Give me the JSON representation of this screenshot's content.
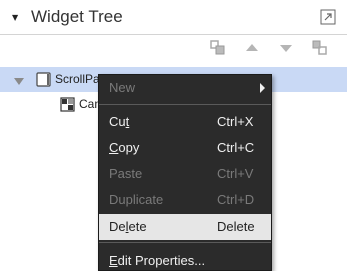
{
  "header": {
    "title": "Widget Tree",
    "collapse_icon": "triangle-down-icon",
    "restore_icon": "restore-window-icon"
  },
  "toolbar": {
    "icons": [
      "wrap-icon",
      "move-up-icon",
      "move-down-icon",
      "unwrap-icon"
    ]
  },
  "tree": {
    "rows": [
      {
        "label": "ScrollPa",
        "icon": "scroll-panel-icon",
        "selected": true,
        "expanded": true
      },
      {
        "label": "Can",
        "icon": "canvas-icon",
        "selected": false
      }
    ]
  },
  "context_menu": {
    "items": [
      {
        "label": "New",
        "shortcut": "",
        "disabled": true,
        "submenu": true,
        "mnemonic": ""
      },
      {
        "label": "Cut",
        "shortcut": "Ctrl+X",
        "disabled": false,
        "mnemonic": "t"
      },
      {
        "label": "Copy",
        "shortcut": "Ctrl+C",
        "disabled": false,
        "mnemonic": "C"
      },
      {
        "label": "Paste",
        "shortcut": "Ctrl+V",
        "disabled": true,
        "mnemonic": ""
      },
      {
        "label": "Duplicate",
        "shortcut": "Ctrl+D",
        "disabled": true,
        "mnemonic": ""
      },
      {
        "label": "Delete",
        "shortcut": "Delete",
        "disabled": false,
        "highlighted": true,
        "mnemonic": "l"
      },
      {
        "label": "Edit Properties...",
        "shortcut": "",
        "disabled": false,
        "mnemonic": "E"
      }
    ]
  },
  "colors": {
    "selection": "#c9d9f5",
    "menu_background": "#2b2b2b",
    "menu_highlight": "#e6e6e6",
    "disabled_text": "#7a7a7a"
  }
}
